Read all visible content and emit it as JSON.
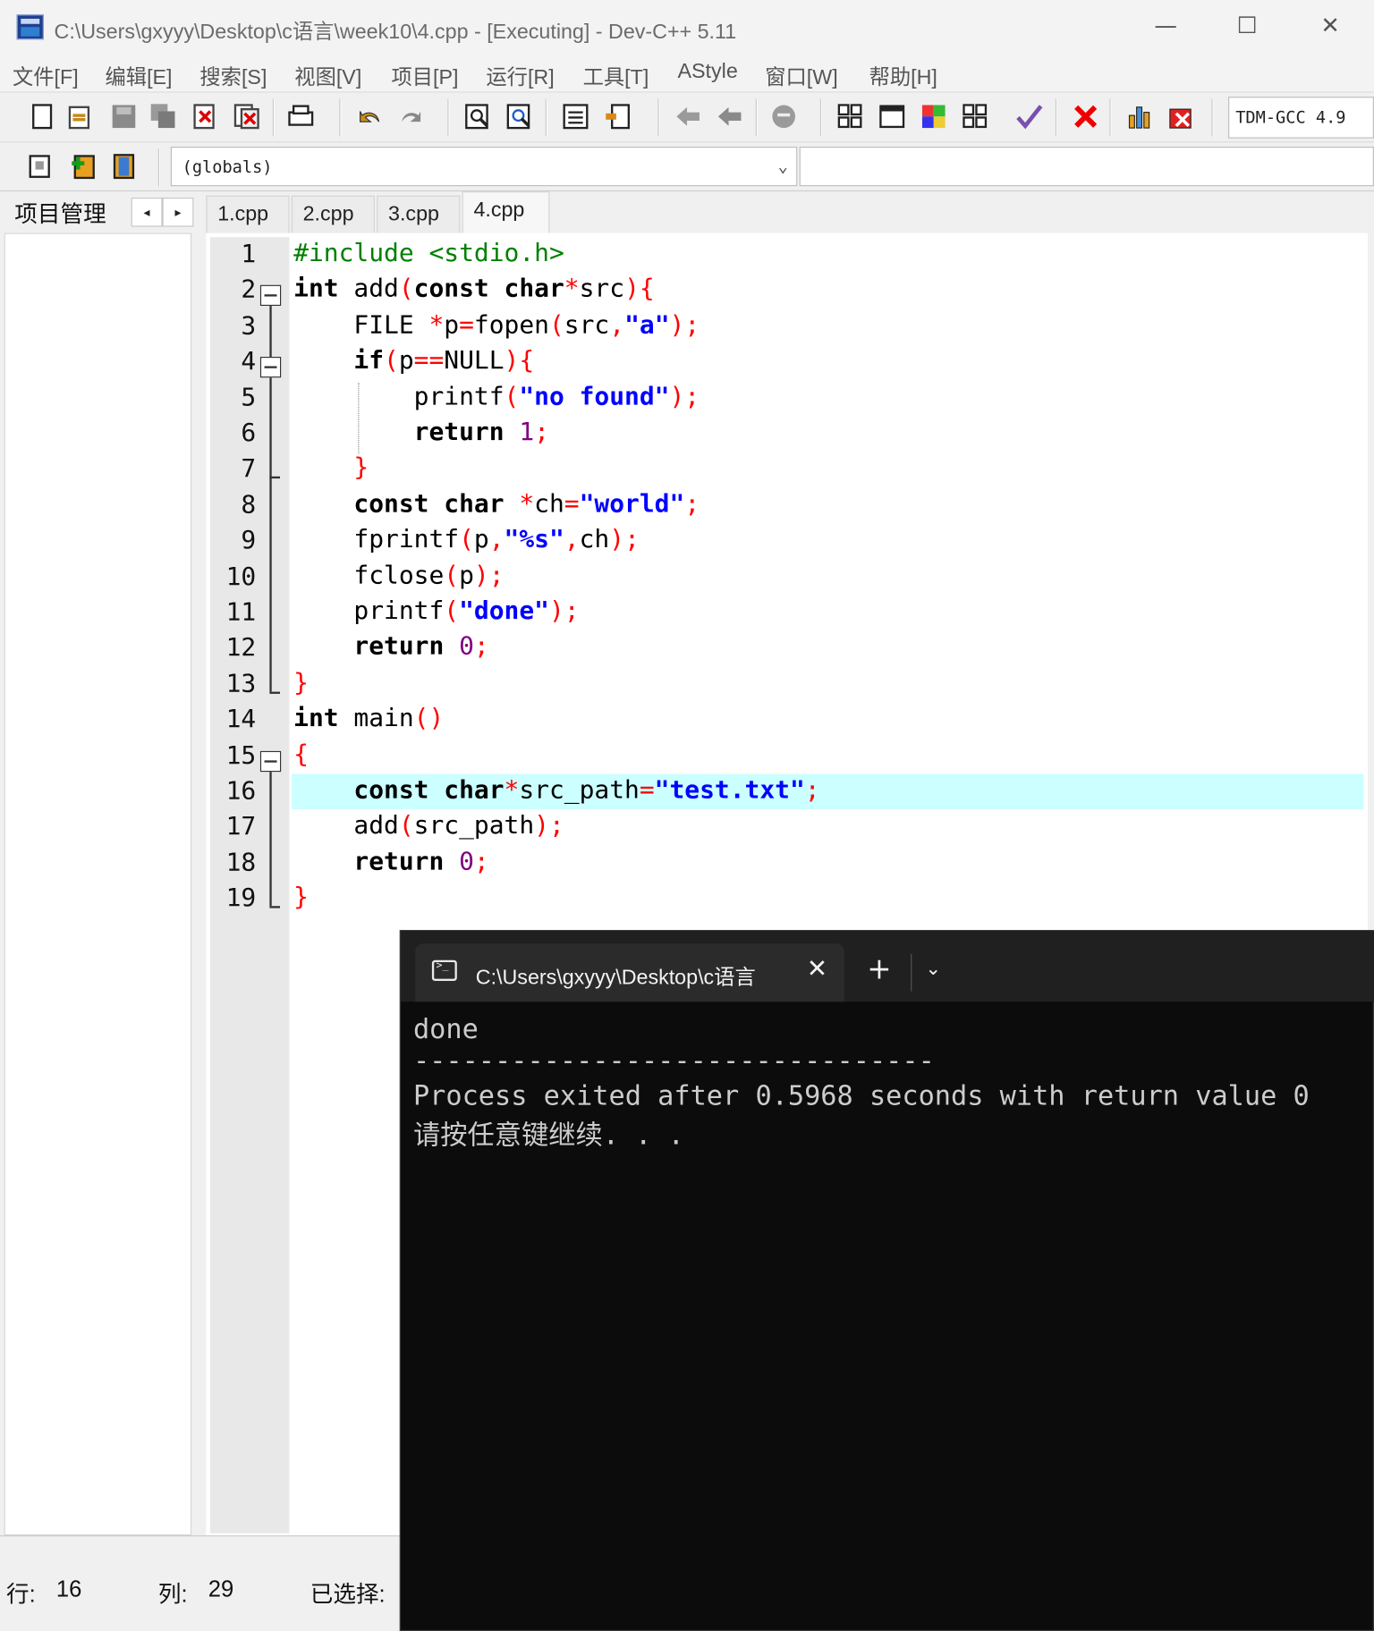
{
  "window": {
    "title": "C:\\Users\\gxyyy\\Desktop\\c语言\\week10\\4.cpp - [Executing] - Dev-C++ 5.11",
    "minimize_glyph": "—",
    "maximize_glyph": "☐",
    "close_glyph": "✕"
  },
  "menu": [
    "文件[F]",
    "编辑[E]",
    "搜索[S]",
    "视图[V]",
    "项目[P]",
    "运行[R]",
    "工具[T]",
    "AStyle",
    "窗口[W]",
    "帮助[H]"
  ],
  "toolbar": {
    "compiler": "TDM-GCC 4.9",
    "scope_combo": "(globals)",
    "icons": [
      "new-file-icon",
      "open-icon",
      "save-icon",
      "save-all-icon",
      "close-icon",
      "close-all-icon",
      "print-icon",
      "undo-icon",
      "redo-icon",
      "find-icon",
      "replace-icon",
      "indent-icon",
      "unindent-icon",
      "back-icon",
      "forward-icon",
      "bookmark-icon",
      "grid-icon",
      "window-icon",
      "colors-icon",
      "layout-icon",
      "check-icon",
      "stop-icon",
      "chart-icon",
      "debug-stop-icon"
    ]
  },
  "left_panel": {
    "tab_label": "项目管理",
    "prev": "◂",
    "next": "▸"
  },
  "tabs": [
    "1.cpp",
    "2.cpp",
    "3.cpp",
    "4.cpp"
  ],
  "active_tab": "4.cpp",
  "editor": {
    "line_numbers": [
      "1",
      "2",
      "3",
      "4",
      "5",
      "6",
      "7",
      "8",
      "9",
      "10",
      "11",
      "12",
      "13",
      "14",
      "15",
      "16",
      "17",
      "18",
      "19"
    ],
    "highlighted_line": 16,
    "lines": [
      [
        {
          "t": "#include <stdio.h>",
          "c": "pp"
        }
      ],
      [
        {
          "t": "int",
          "c": "ty"
        },
        {
          "t": " add",
          "c": "id"
        },
        {
          "t": "(",
          "c": "sym"
        },
        {
          "t": "const",
          "c": "kw"
        },
        {
          "t": " ",
          "c": "id"
        },
        {
          "t": "char",
          "c": "ty"
        },
        {
          "t": "*",
          "c": "sym"
        },
        {
          "t": "src",
          "c": "id"
        },
        {
          "t": "){",
          "c": "sym"
        }
      ],
      [
        {
          "t": "    FILE ",
          "c": "id"
        },
        {
          "t": "*",
          "c": "sym"
        },
        {
          "t": "p",
          "c": "id"
        },
        {
          "t": "=",
          "c": "sym"
        },
        {
          "t": "fopen",
          "c": "id"
        },
        {
          "t": "(",
          "c": "sym"
        },
        {
          "t": "src",
          "c": "id"
        },
        {
          "t": ",",
          "c": "sym"
        },
        {
          "t": "\"a\"",
          "c": "str"
        },
        {
          "t": ");",
          "c": "sym"
        }
      ],
      [
        {
          "t": "    ",
          "c": "id"
        },
        {
          "t": "if",
          "c": "kw"
        },
        {
          "t": "(",
          "c": "sym"
        },
        {
          "t": "p",
          "c": "id"
        },
        {
          "t": "==",
          "c": "sym"
        },
        {
          "t": "NULL",
          "c": "id"
        },
        {
          "t": "){",
          "c": "sym"
        }
      ],
      [
        {
          "t": "        printf",
          "c": "id"
        },
        {
          "t": "(",
          "c": "sym"
        },
        {
          "t": "\"no found\"",
          "c": "str"
        },
        {
          "t": ");",
          "c": "sym"
        }
      ],
      [
        {
          "t": "        ",
          "c": "id"
        },
        {
          "t": "return",
          "c": "kw"
        },
        {
          "t": " ",
          "c": "id"
        },
        {
          "t": "1",
          "c": "num"
        },
        {
          "t": ";",
          "c": "sym"
        }
      ],
      [
        {
          "t": "    ",
          "c": "id"
        },
        {
          "t": "}",
          "c": "sym"
        }
      ],
      [
        {
          "t": "    ",
          "c": "id"
        },
        {
          "t": "const",
          "c": "kw"
        },
        {
          "t": " ",
          "c": "id"
        },
        {
          "t": "char",
          "c": "ty"
        },
        {
          "t": " ",
          "c": "id"
        },
        {
          "t": "*",
          "c": "sym"
        },
        {
          "t": "ch",
          "c": "id"
        },
        {
          "t": "=",
          "c": "sym"
        },
        {
          "t": "\"world\"",
          "c": "str"
        },
        {
          "t": ";",
          "c": "sym"
        }
      ],
      [
        {
          "t": "    fprintf",
          "c": "id"
        },
        {
          "t": "(",
          "c": "sym"
        },
        {
          "t": "p",
          "c": "id"
        },
        {
          "t": ",",
          "c": "sym"
        },
        {
          "t": "\"%s\"",
          "c": "str"
        },
        {
          "t": ",",
          "c": "sym"
        },
        {
          "t": "ch",
          "c": "id"
        },
        {
          "t": ");",
          "c": "sym"
        }
      ],
      [
        {
          "t": "    fclose",
          "c": "id"
        },
        {
          "t": "(",
          "c": "sym"
        },
        {
          "t": "p",
          "c": "id"
        },
        {
          "t": ");",
          "c": "sym"
        }
      ],
      [
        {
          "t": "    printf",
          "c": "id"
        },
        {
          "t": "(",
          "c": "sym"
        },
        {
          "t": "\"done\"",
          "c": "str"
        },
        {
          "t": ");",
          "c": "sym"
        }
      ],
      [
        {
          "t": "    ",
          "c": "id"
        },
        {
          "t": "return",
          "c": "kw"
        },
        {
          "t": " ",
          "c": "id"
        },
        {
          "t": "0",
          "c": "num"
        },
        {
          "t": ";",
          "c": "sym"
        }
      ],
      [
        {
          "t": "}",
          "c": "sym"
        }
      ],
      [
        {
          "t": "int",
          "c": "ty"
        },
        {
          "t": " main",
          "c": "id"
        },
        {
          "t": "()",
          "c": "sym"
        }
      ],
      [
        {
          "t": "{",
          "c": "sym"
        }
      ],
      [
        {
          "t": "    ",
          "c": "id"
        },
        {
          "t": "const",
          "c": "kw"
        },
        {
          "t": " ",
          "c": "id"
        },
        {
          "t": "char",
          "c": "ty"
        },
        {
          "t": "*",
          "c": "sym"
        },
        {
          "t": "src_path",
          "c": "id"
        },
        {
          "t": "=",
          "c": "sym"
        },
        {
          "t": "\"test.txt\"",
          "c": "str"
        },
        {
          "t": ";",
          "c": "sym"
        }
      ],
      [
        {
          "t": "    add",
          "c": "id"
        },
        {
          "t": "(",
          "c": "sym"
        },
        {
          "t": "src_path",
          "c": "id"
        },
        {
          "t": ");",
          "c": "sym"
        }
      ],
      [
        {
          "t": "    ",
          "c": "id"
        },
        {
          "t": "return",
          "c": "kw"
        },
        {
          "t": " ",
          "c": "id"
        },
        {
          "t": "0",
          "c": "num"
        },
        {
          "t": ";",
          "c": "sym"
        }
      ],
      [
        {
          "t": "}",
          "c": "sym"
        }
      ]
    ]
  },
  "status": {
    "row_label": "行:",
    "row_value": "16",
    "col_label": "列:",
    "col_value": "29",
    "selected_label": "已选择:"
  },
  "console": {
    "tab_title": "C:\\Users\\gxyyy\\Desktop\\c语言",
    "close_glyph": "✕",
    "plus_glyph": "+",
    "dropdown_glyph": "⌄",
    "output": [
      "done",
      "--------------------------------",
      "Process exited after 0.5968 seconds with return value 0",
      "请按任意键继续. . ."
    ]
  },
  "colors": {
    "keyword": "#000000",
    "preprocessor": "#008000",
    "symbol": "#ff0000",
    "string": "#0000ff",
    "number": "#800080",
    "current_line": "#ccffff",
    "console_bg": "#0c0c0c"
  }
}
